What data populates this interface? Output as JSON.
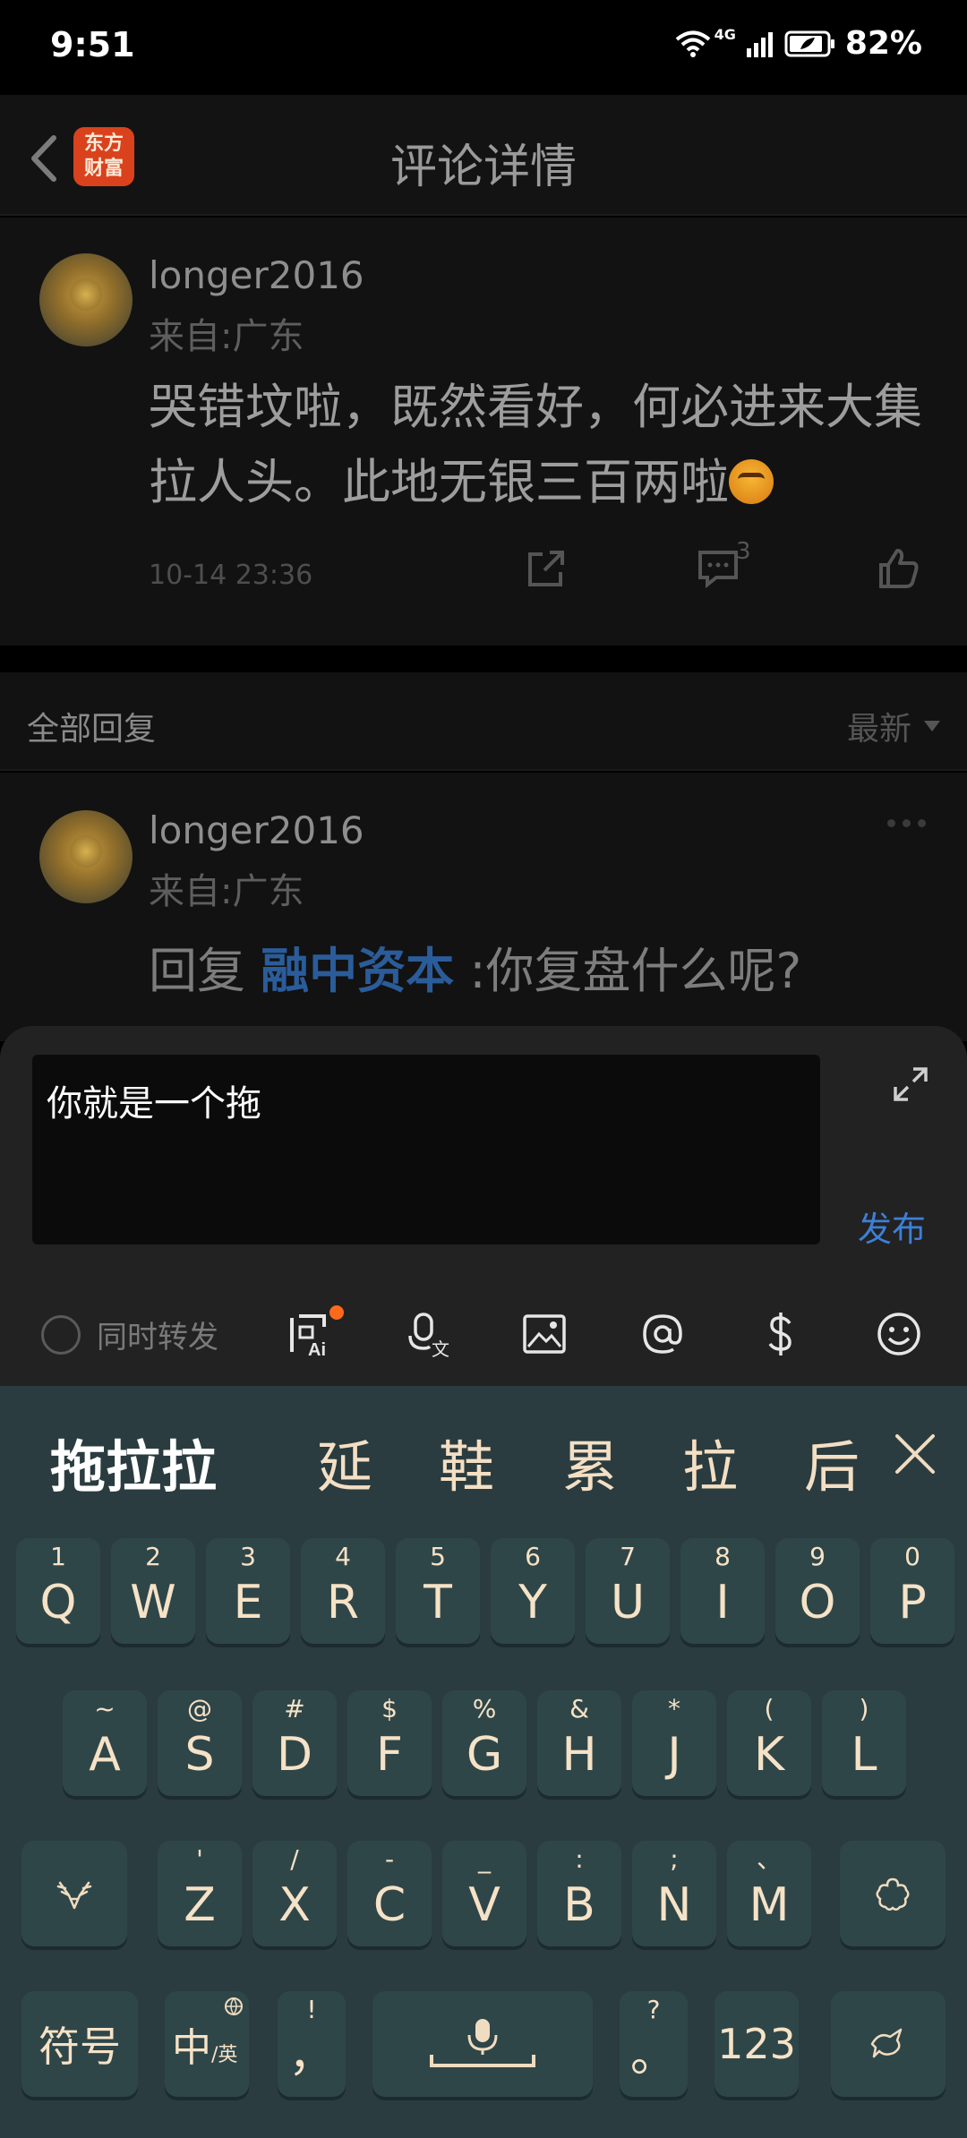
{
  "status_bar": {
    "time": "9:51",
    "network": "4G",
    "battery": "82%"
  },
  "header": {
    "title": "评论详情",
    "logo_line1": "东方",
    "logo_line2": "财富"
  },
  "comment": {
    "username": "longer2016",
    "location": "来自:广东",
    "text": "哭错坟啦，既然看好，何必进来大集拉人头。此地无银三百两啦",
    "time": "10-14 23:36",
    "reply_count": "3"
  },
  "replies": {
    "title": "全部回复",
    "sort": "最新"
  },
  "reply": {
    "username": "longer2016",
    "location": "来自:广东",
    "prefix": "回复",
    "mention": "融中资本",
    "text": ":你复盘什么呢?"
  },
  "composer": {
    "input_value": "你就是一个拖",
    "publish_label": "发布",
    "repost_label": "同时转发"
  },
  "keyboard": {
    "candidates": [
      "拖拉拉",
      "延",
      "鞋",
      "累",
      "拉",
      "后"
    ],
    "row1": [
      {
        "main": "Q",
        "sub": "1"
      },
      {
        "main": "W",
        "sub": "2"
      },
      {
        "main": "E",
        "sub": "3"
      },
      {
        "main": "R",
        "sub": "4"
      },
      {
        "main": "T",
        "sub": "5"
      },
      {
        "main": "Y",
        "sub": "6"
      },
      {
        "main": "U",
        "sub": "7"
      },
      {
        "main": "I",
        "sub": "8"
      },
      {
        "main": "O",
        "sub": "9"
      },
      {
        "main": "P",
        "sub": "0"
      }
    ],
    "row2": [
      {
        "main": "A",
        "sub": "~"
      },
      {
        "main": "S",
        "sub": "@"
      },
      {
        "main": "D",
        "sub": "#"
      },
      {
        "main": "F",
        "sub": "$"
      },
      {
        "main": "G",
        "sub": "%"
      },
      {
        "main": "H",
        "sub": "&"
      },
      {
        "main": "J",
        "sub": "*"
      },
      {
        "main": "K",
        "sub": "("
      },
      {
        "main": "L",
        "sub": ")"
      }
    ],
    "row3": [
      {
        "main": "Z",
        "sub": "'"
      },
      {
        "main": "X",
        "sub": "/"
      },
      {
        "main": "C",
        "sub": "-"
      },
      {
        "main": "V",
        "sub": "_"
      },
      {
        "main": "B",
        "sub": ":"
      },
      {
        "main": "N",
        "sub": ";"
      },
      {
        "main": "M",
        "sub": "、"
      }
    ],
    "symbols_label": "符号",
    "lang_main": "中",
    "lang_sub": "/英",
    "comma_main": "，",
    "comma_sub": "!",
    "period_main": "。",
    "period_sub": "?",
    "numbers_label": "123"
  }
}
